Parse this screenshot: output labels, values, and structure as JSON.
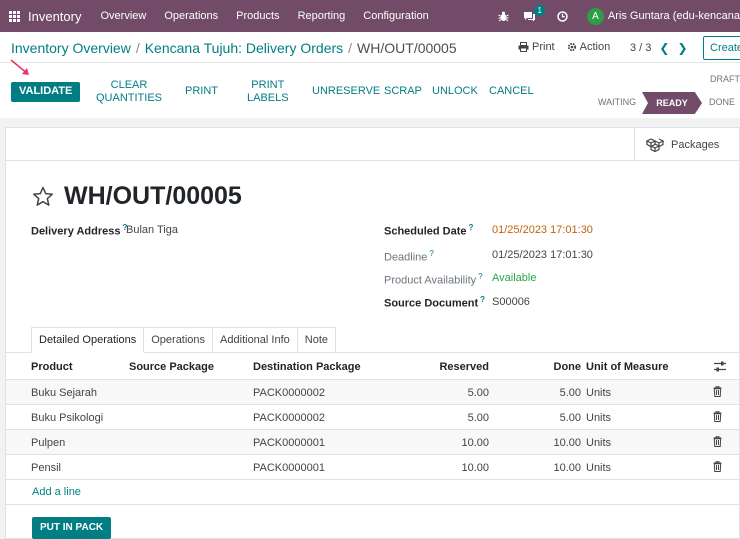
{
  "navbar": {
    "app_name": "Inventory",
    "menu": [
      "Overview",
      "Operations",
      "Products",
      "Reporting",
      "Configuration"
    ],
    "messages_count": "1",
    "user_initial": "A",
    "user_name": "Aris Guntara (edu-kencana"
  },
  "breadcrumb": {
    "items": [
      "Inventory Overview",
      "Kencana Tujuh: Delivery Orders"
    ],
    "current": "WH/OUT/00005"
  },
  "toolbar": {
    "print_label": "Print",
    "action_label": "Action",
    "pager": "3 / 3",
    "create_label": "Create"
  },
  "actions": {
    "validate": "VALIDATE",
    "clear_quantities": [
      "CLEAR",
      "QUANTITIES"
    ],
    "print": "PRINT",
    "print_labels": [
      "PRINT",
      "LABELS"
    ],
    "unreserve": "UNRESERVE",
    "scrap": "SCRAP",
    "unlock": "UNLOCK",
    "cancel": "CANCEL"
  },
  "statusbar": {
    "draft": "DRAFT",
    "waiting": "WAITING",
    "ready": "READY",
    "done": "DONE",
    "active": "READY"
  },
  "form": {
    "packages_label": "Packages",
    "title": "WH/OUT/00005",
    "delivery_address_label": "Delivery Address",
    "delivery_address": "Bulan Tiga",
    "scheduled_date_label": "Scheduled Date",
    "scheduled_date": "01/25/2023 17:01:30",
    "deadline_label": "Deadline",
    "deadline": "01/25/2023 17:01:30",
    "availability_label": "Product Availability",
    "availability": "Available",
    "source_document_label": "Source Document",
    "source_document": "S00006",
    "help_mark": "?"
  },
  "tabs": [
    "Detailed Operations",
    "Operations",
    "Additional Info",
    "Note"
  ],
  "table": {
    "headers": {
      "product": "Product",
      "source_package": "Source Package",
      "destination_package": "Destination Package",
      "reserved": "Reserved",
      "done": "Done",
      "uom": "Unit of Measure"
    },
    "rows": [
      {
        "product": "Buku Sejarah",
        "source_package": "",
        "destination_package": "PACK0000002",
        "reserved": "5.00",
        "done": "5.00",
        "uom": "Units"
      },
      {
        "product": "Buku Psikologi",
        "source_package": "",
        "destination_package": "PACK0000002",
        "reserved": "5.00",
        "done": "5.00",
        "uom": "Units"
      },
      {
        "product": "Pulpen",
        "source_package": "",
        "destination_package": "PACK0000001",
        "reserved": "10.00",
        "done": "10.00",
        "uom": "Units"
      },
      {
        "product": "Pensil",
        "source_package": "",
        "destination_package": "PACK0000001",
        "reserved": "10.00",
        "done": "10.00",
        "uom": "Units"
      }
    ],
    "add_line": "Add a line"
  },
  "put_in_pack": "PUT IN PACK",
  "colors": {
    "brand": "#714b67",
    "accent": "#017e84",
    "scheduled_date": "#c0620f",
    "available": "#28a745",
    "annotation_arrow": "#e8336b"
  }
}
